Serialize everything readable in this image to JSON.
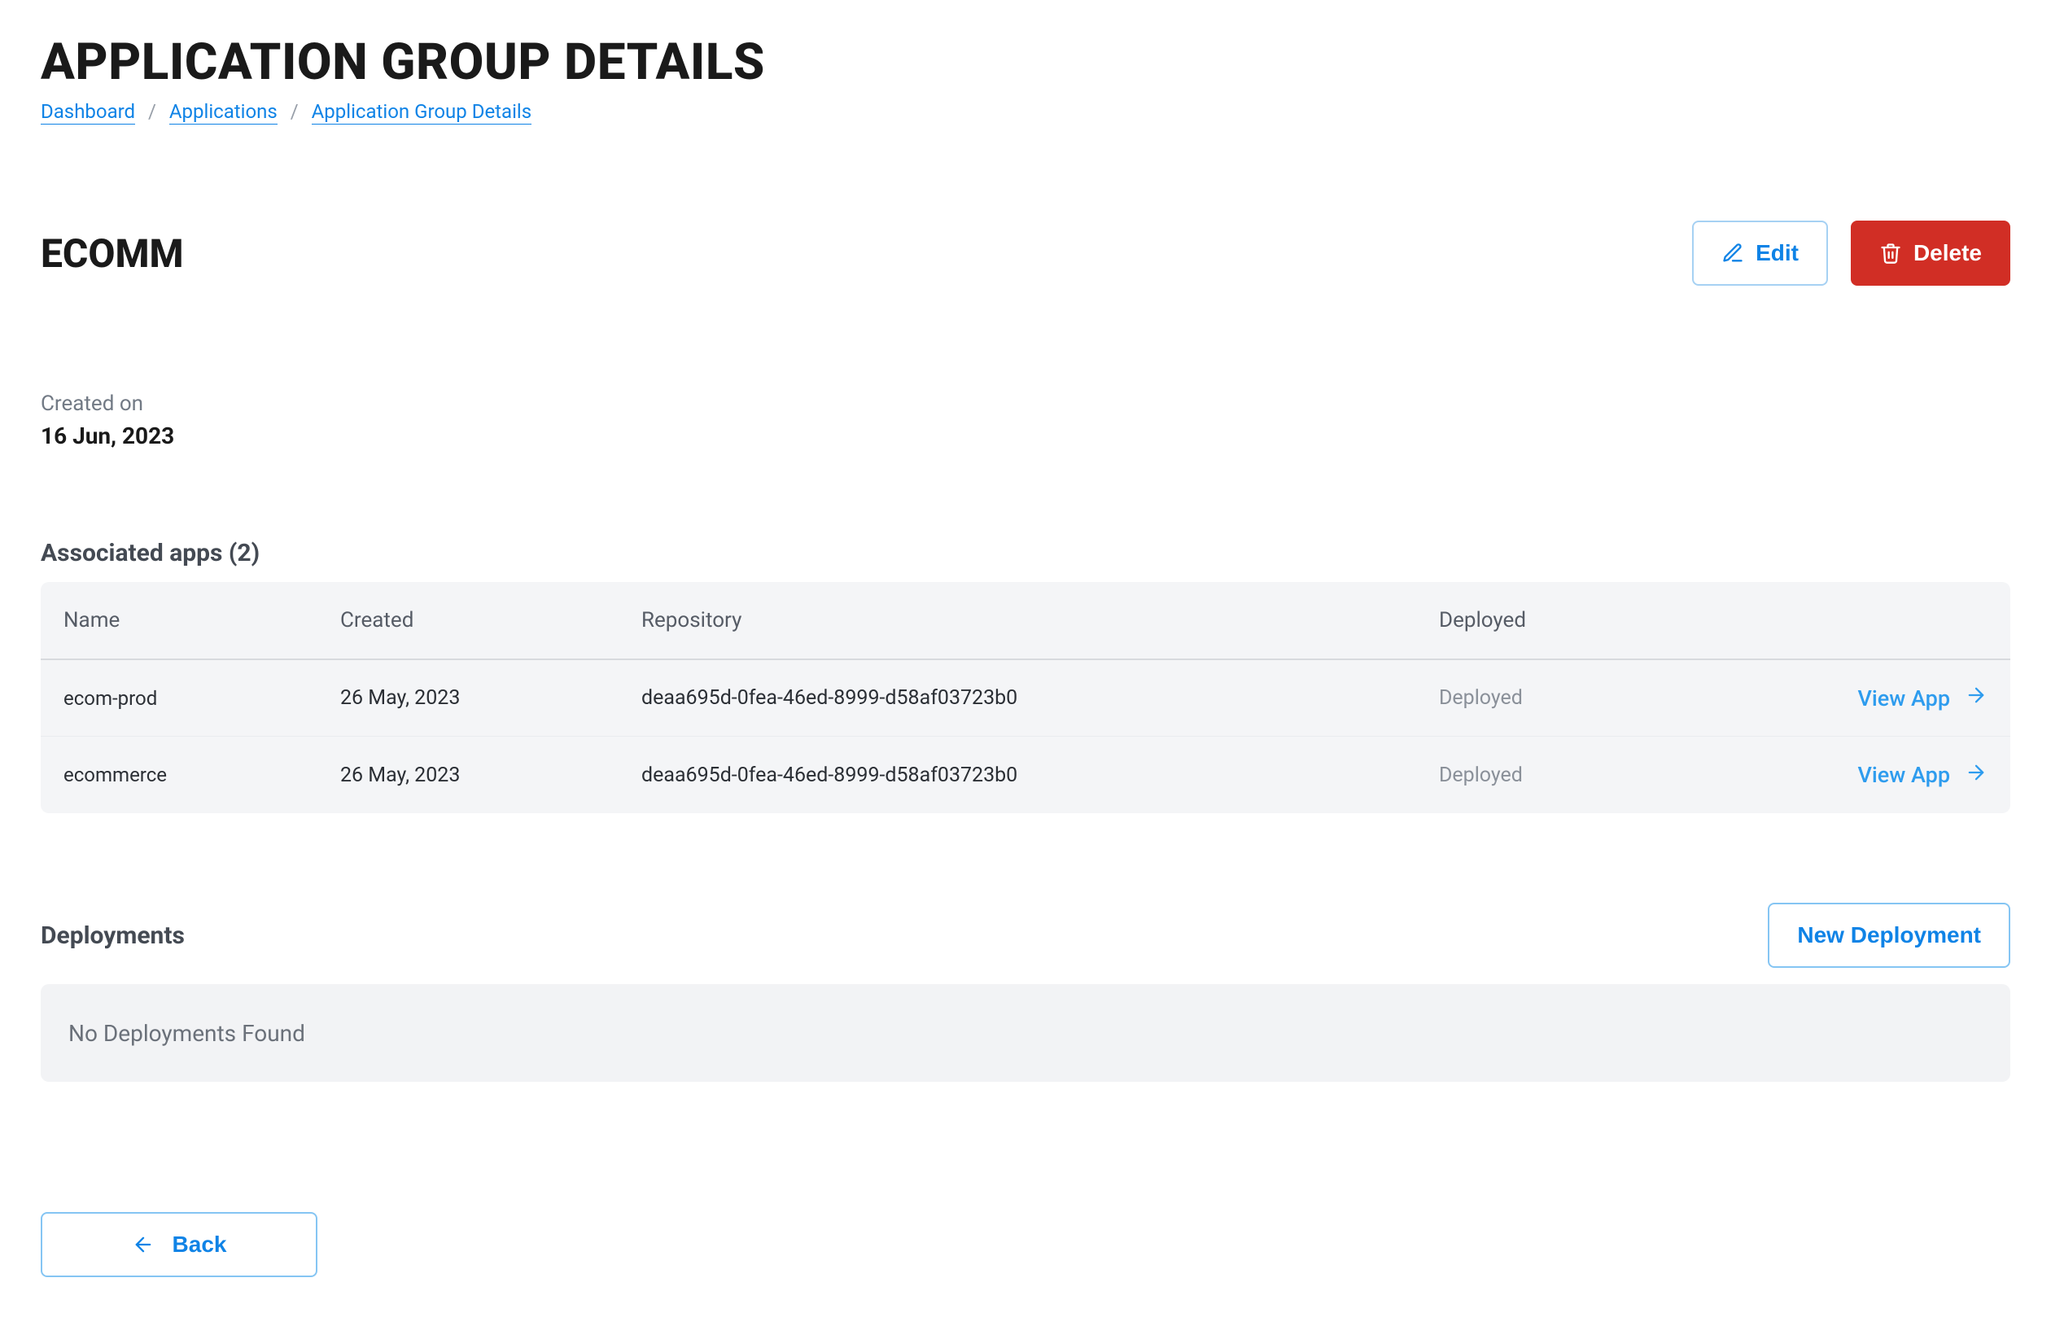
{
  "header": {
    "page_title": "APPLICATION GROUP DETAILS",
    "breadcrumbs": [
      "Dashboard",
      "Applications",
      "Application Group Details"
    ]
  },
  "group": {
    "name": "ECOMM",
    "edit_label": "Edit",
    "delete_label": "Delete",
    "created_label": "Created on",
    "created_value": "16 Jun, 2023"
  },
  "apps": {
    "heading": "Associated apps (2)",
    "columns": {
      "name": "Name",
      "created": "Created",
      "repo": "Repository",
      "deployed": "Deployed"
    },
    "view_label": "View App",
    "rows": [
      {
        "name": "ecom-prod",
        "created": "26 May, 2023",
        "repo": "deaa695d-0fea-46ed-8999-d58af03723b0",
        "deployed": "Deployed"
      },
      {
        "name": "ecommerce",
        "created": "26 May, 2023",
        "repo": "deaa695d-0fea-46ed-8999-d58af03723b0",
        "deployed": "Deployed"
      }
    ]
  },
  "deployments": {
    "heading": "Deployments",
    "new_label": "New Deployment",
    "empty": "No Deployments Found"
  },
  "back_label": "Back"
}
